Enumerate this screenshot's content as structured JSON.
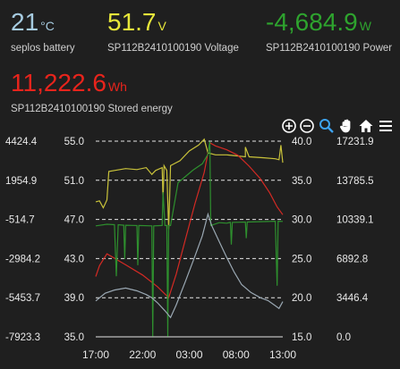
{
  "stats": {
    "battery": {
      "value": "21",
      "unit": "°C",
      "label": "seplos battery",
      "color": "#a6cbe0"
    },
    "voltage": {
      "value": "51.7",
      "unit": "V",
      "label": "SP112B2410100190 Voltage",
      "color": "#e8e83a"
    },
    "power": {
      "value": "-4,684.9",
      "unit": "W",
      "label": "SP112B2410100190 Power",
      "color": "#2ea32e"
    },
    "energy": {
      "value": "11,222.6",
      "unit": "Wh",
      "label": "SP112B2410100190 Stored energy",
      "color": "#e8241c"
    }
  },
  "toolbar": {
    "icons": [
      "zoom-in-icon",
      "zoom-out-icon",
      "magnify-icon",
      "pan-hand-icon",
      "home-icon",
      "menu-icon"
    ]
  },
  "chart_data": {
    "type": "line",
    "x_ticks": [
      "17:00",
      "22:00",
      "03:00",
      "08:00",
      "13:00"
    ],
    "axes": {
      "power_left": {
        "ticks": [
          "4424.4",
          "1954.9",
          "-514.7",
          "-2984.2",
          "-5453.7",
          "-7923.3"
        ],
        "range": [
          -7923.3,
          4424.4
        ]
      },
      "voltage_left": {
        "ticks": [
          "55.0",
          "51.0",
          "47.0",
          "43.0",
          "39.0",
          "35.0"
        ],
        "range": [
          35.0,
          55.0
        ]
      },
      "temperature_right": {
        "ticks": [
          "40.0",
          "35.0",
          "30.0",
          "25.0",
          "20.0",
          "15.0"
        ],
        "range": [
          15.0,
          40.0
        ]
      },
      "energy_right": {
        "ticks": [
          "17231.9",
          "13785.5",
          "10339.1",
          "6892.8",
          "3446.4",
          "0.0"
        ],
        "range": [
          0.0,
          17231.9
        ]
      }
    },
    "grid": true,
    "series": [
      {
        "axis": "voltage_left",
        "color": "#c9c23a",
        "points": [
          [
            0,
            48.8
          ],
          [
            0.02,
            48.9
          ],
          [
            0.04,
            48.2
          ],
          [
            0.05,
            48.6
          ],
          [
            0.06,
            49.0
          ],
          [
            0.07,
            51.9
          ],
          [
            0.1,
            52.0
          ],
          [
            0.16,
            52.2
          ],
          [
            0.22,
            52.1
          ],
          [
            0.27,
            52.3
          ],
          [
            0.3,
            51.6
          ],
          [
            0.32,
            52.0
          ],
          [
            0.355,
            52.3
          ],
          [
            0.36,
            49.0
          ],
          [
            0.365,
            52.5
          ],
          [
            0.38,
            52.0
          ],
          [
            0.39,
            46.0
          ],
          [
            0.4,
            52.5
          ],
          [
            0.45,
            53.0
          ],
          [
            0.5,
            54.0
          ],
          [
            0.55,
            54.6
          ],
          [
            0.58,
            55.2
          ],
          [
            0.6,
            53.8
          ],
          [
            0.64,
            53.6
          ],
          [
            0.7,
            53.6
          ],
          [
            0.75,
            53.5
          ],
          [
            0.8,
            53.4
          ],
          [
            0.8,
            54.4
          ],
          [
            0.82,
            53.4
          ],
          [
            0.9,
            53.3
          ],
          [
            0.96,
            53.2
          ],
          [
            0.98,
            53.1
          ],
          [
            0.99,
            54.6
          ],
          [
            1.0,
            52.8
          ]
        ]
      },
      {
        "axis": "temperature_right",
        "color": "#d42a24",
        "points": [
          [
            0,
            22.7
          ],
          [
            0.02,
            24.1
          ],
          [
            0.06,
            25.6
          ],
          [
            0.16,
            24.2
          ],
          [
            0.25,
            22.9
          ],
          [
            0.33,
            21.4
          ],
          [
            0.39,
            20.0
          ],
          [
            0.43,
            23.0
          ],
          [
            0.48,
            27.5
          ],
          [
            0.53,
            32.0
          ],
          [
            0.58,
            36.0
          ],
          [
            0.61,
            39.8
          ],
          [
            0.64,
            39.4
          ],
          [
            0.7,
            38.9
          ],
          [
            0.76,
            38.2
          ],
          [
            0.82,
            36.8
          ],
          [
            0.88,
            35.2
          ],
          [
            0.93,
            33.4
          ],
          [
            0.97,
            31.6
          ],
          [
            1.0,
            30.6
          ]
        ]
      },
      {
        "axis": "power_left",
        "color": "#2e8f2e",
        "points": [
          [
            0,
            -920
          ],
          [
            0.06,
            -820
          ],
          [
            0.1,
            -850
          ],
          [
            0.11,
            -4100
          ],
          [
            0.12,
            -850
          ],
          [
            0.15,
            -880
          ],
          [
            0.155,
            -3000
          ],
          [
            0.16,
            -880
          ],
          [
            0.22,
            -900
          ],
          [
            0.225,
            -3400
          ],
          [
            0.23,
            -900
          ],
          [
            0.3,
            -920
          ],
          [
            0.305,
            -7900
          ],
          [
            0.31,
            -920
          ],
          [
            0.355,
            -900
          ],
          [
            0.36,
            1200
          ],
          [
            0.37,
            -900
          ],
          [
            0.38,
            -900
          ],
          [
            0.385,
            -7900
          ],
          [
            0.39,
            -900
          ],
          [
            0.4,
            -900
          ],
          [
            0.44,
            1800
          ],
          [
            0.48,
            2200
          ],
          [
            0.52,
            2600
          ],
          [
            0.57,
            3000
          ],
          [
            0.6,
            3600
          ],
          [
            0.61,
            4400
          ],
          [
            0.615,
            -900
          ],
          [
            0.66,
            -720
          ],
          [
            0.7,
            -750
          ],
          [
            0.72,
            -700
          ],
          [
            0.725,
            -2100
          ],
          [
            0.73,
            -700
          ],
          [
            0.8,
            -680
          ],
          [
            0.805,
            -1700
          ],
          [
            0.81,
            -680
          ],
          [
            0.9,
            -650
          ],
          [
            0.96,
            -630
          ],
          [
            0.97,
            -4700
          ],
          [
            0.975,
            -630
          ],
          [
            1.0,
            -640
          ]
        ]
      },
      {
        "axis": "energy_right",
        "color": "#9aa8b3",
        "points": [
          [
            0,
            3160
          ],
          [
            0.05,
            3840
          ],
          [
            0.1,
            4120
          ],
          [
            0.16,
            4300
          ],
          [
            0.22,
            4050
          ],
          [
            0.27,
            3720
          ],
          [
            0.3,
            3440
          ],
          [
            0.33,
            3000
          ],
          [
            0.37,
            2300
          ],
          [
            0.4,
            1700
          ],
          [
            0.43,
            2800
          ],
          [
            0.48,
            4900
          ],
          [
            0.53,
            7100
          ],
          [
            0.57,
            8900
          ],
          [
            0.6,
            10800
          ],
          [
            0.62,
            9800
          ],
          [
            0.66,
            8400
          ],
          [
            0.7,
            7000
          ],
          [
            0.74,
            5700
          ],
          [
            0.78,
            4600
          ],
          [
            0.83,
            3900
          ],
          [
            0.88,
            3450
          ],
          [
            0.92,
            3200
          ],
          [
            0.96,
            2750
          ],
          [
            0.98,
            2500
          ],
          [
            1.0,
            3100
          ]
        ]
      }
    ]
  }
}
